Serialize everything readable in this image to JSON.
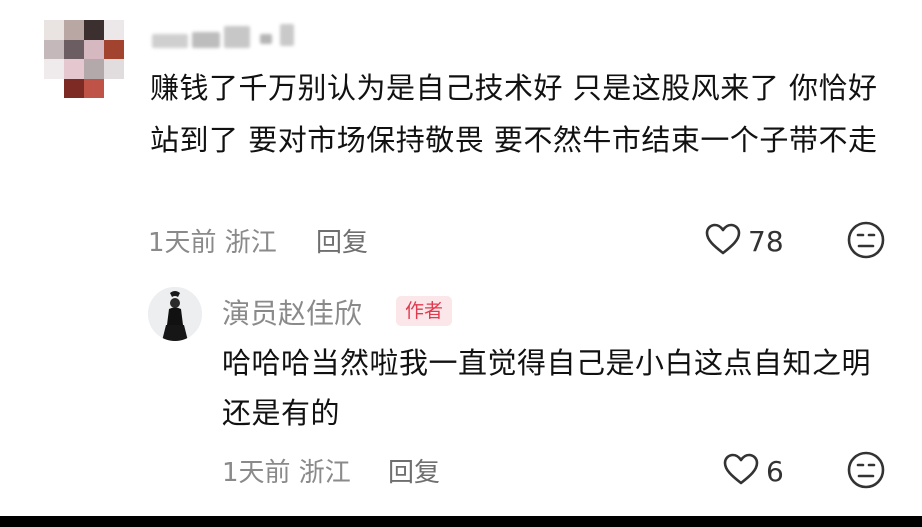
{
  "comment": {
    "text": "赚钱了千万别认为是自己技术好 只是这股风来了 你恰好站到了 要对市场保持敬畏 要不然牛市结束一个子带不走",
    "meta": "1天前 浙江",
    "reply_label": "回复",
    "likes": "78"
  },
  "reply": {
    "username": "演员赵佳欣",
    "badge": "作者",
    "text": "哈哈哈当然啦我一直觉得自己是小白这点自知之明还是有的",
    "meta": "1天前 浙江",
    "reply_label": "回复",
    "likes": "6"
  },
  "icons": {
    "like": "heart-outline-icon",
    "dislike": "neutral-face-icon",
    "badge_color": "#e13a4f"
  }
}
